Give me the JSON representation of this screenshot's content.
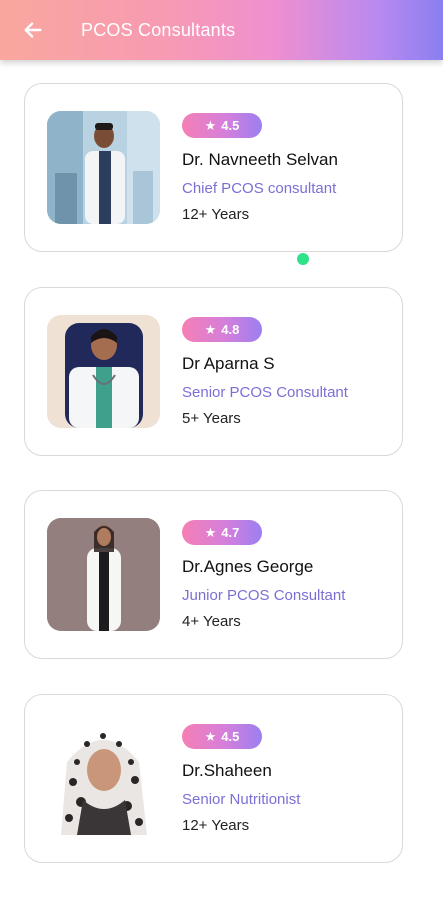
{
  "appbar": {
    "title": "PCOS Consultants",
    "back_icon": "arrow-left-icon"
  },
  "colors": {
    "appbar_gradient": [
      "#f9a79e",
      "#ef8fd0",
      "#8a7ff0"
    ],
    "rating_gradient": [
      "#f57fb4",
      "#9b7ff0"
    ],
    "role_text": "#7a6fd6",
    "indicator": "#2ee28a"
  },
  "consultants": [
    {
      "rating": "4.5",
      "name": "Dr. Navneeth Selvan",
      "role": "Chief PCOS consultant",
      "experience": "12+ Years"
    },
    {
      "rating": "4.8",
      "name": "Dr Aparna S",
      "role": "Senior PCOS Consultant",
      "experience": "5+ Years"
    },
    {
      "rating": "4.7",
      "name": "Dr.Agnes George",
      "role": "Junior PCOS Consultant",
      "experience": "4+ Years"
    },
    {
      "rating": "4.5",
      "name": "Dr.Shaheen",
      "role": "Senior Nutritionist",
      "experience": "12+ Years"
    }
  ]
}
